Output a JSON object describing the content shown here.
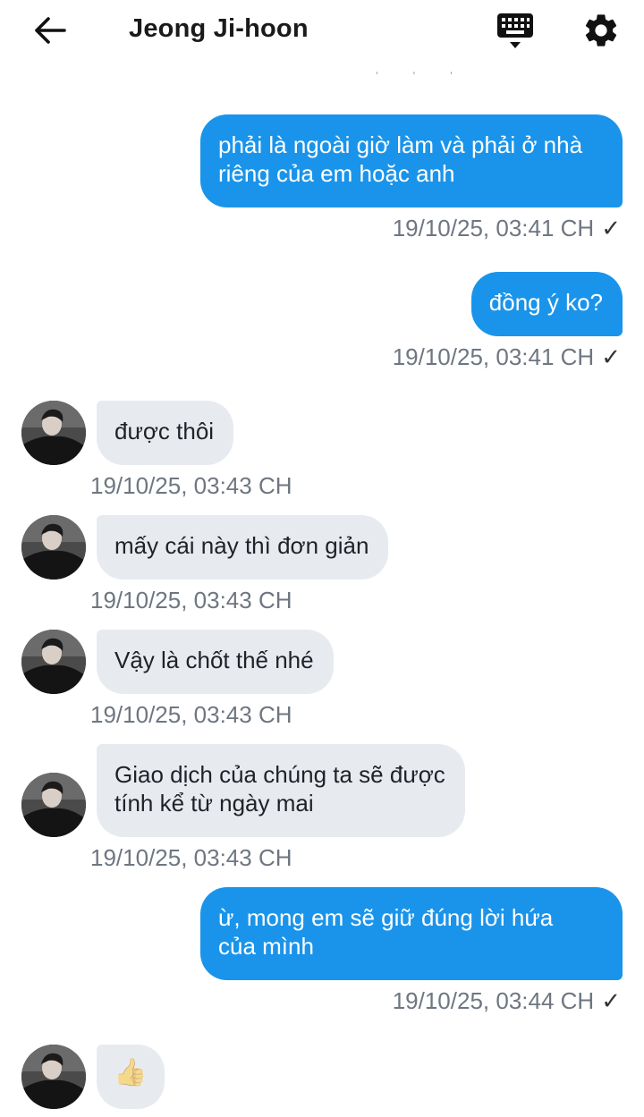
{
  "header": {
    "title": "Jeong Ji-hoon",
    "back_icon": "back-arrow-icon",
    "keyboard_icon": "keyboard-icon",
    "settings_icon": "gear-icon"
  },
  "messages": [
    {
      "side": "out",
      "text_lines": [
        "phải là ngoài giờ làm và phải ở nhà",
        "riêng của em hoặc anh"
      ],
      "time": "19/10/25, 03:41 CH",
      "status": "✓"
    },
    {
      "side": "out",
      "text_lines": [
        "đồng ý ko?"
      ],
      "time": "19/10/25, 03:41 CH",
      "status": "✓"
    },
    {
      "side": "in",
      "text_lines": [
        "được thôi"
      ],
      "time": "19/10/25, 03:43 CH"
    },
    {
      "side": "in",
      "text_lines": [
        "mấy cái này thì đơn giản"
      ],
      "time": "19/10/25, 03:43 CH"
    },
    {
      "side": "in",
      "text_lines": [
        "Vậy là chốt thế nhé"
      ],
      "time": "19/10/25, 03:43 CH"
    },
    {
      "side": "in",
      "text_lines": [
        "Giao dịch của chúng ta sẽ được",
        "tính kể từ ngày mai"
      ],
      "time": "19/10/25, 03:43 CH"
    },
    {
      "side": "out",
      "text_lines": [
        "ừ, mong em sẽ giữ đúng lời hứa",
        "của mình"
      ],
      "time": "19/10/25, 03:44 CH",
      "status": "✓"
    },
    {
      "side": "in",
      "emoji": "👍"
    }
  ],
  "colors": {
    "outgoing_bubble": "#1a94ea",
    "incoming_bubble": "#e7ebf0",
    "timestamp": "#6e7681"
  }
}
